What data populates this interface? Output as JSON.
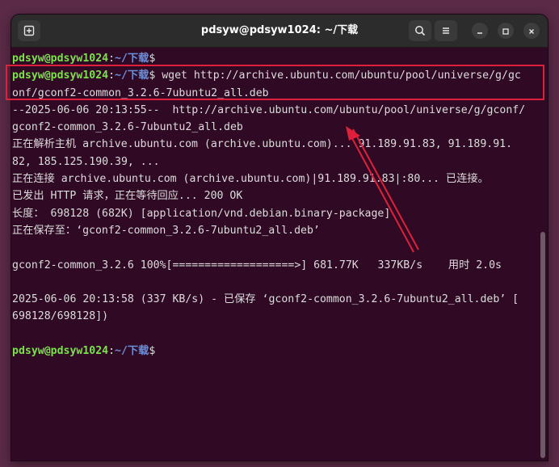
{
  "window": {
    "title": "pdsyw@pdsyw1024: ~/下载"
  },
  "titlebar_icons": {
    "new_tab": "new-tab-icon",
    "search": "search-icon",
    "menu": "hamburger-menu-icon",
    "minimize": "minimize-icon",
    "maximize": "maximize-icon",
    "close": "close-icon"
  },
  "prompt": {
    "user": "pdsyw@pdsyw1024",
    "sep": ":",
    "path": "~/下载",
    "sym": "$"
  },
  "terminal_lines": [
    {
      "type": "prompt",
      "cmd": ""
    },
    {
      "type": "prompt",
      "cmd": " wget http://archive.ubuntu.com/ubuntu/pool/universe/g/gc"
    },
    {
      "type": "text",
      "text": "onf/gconf2-common_3.2.6-7ubuntu2_all.deb"
    },
    {
      "type": "text",
      "text": "--2025-06-06 20:13:55--  http://archive.ubuntu.com/ubuntu/pool/universe/g/gconf/"
    },
    {
      "type": "text",
      "text": "gconf2-common_3.2.6-7ubuntu2_all.deb"
    },
    {
      "type": "text",
      "text": "正在解析主机 archive.ubuntu.com (archive.ubuntu.com)... 91.189.91.83, 91.189.91."
    },
    {
      "type": "text",
      "text": "82, 185.125.190.39, ..."
    },
    {
      "type": "text",
      "text": "正在连接 archive.ubuntu.com (archive.ubuntu.com)|91.189.91.83|:80... 已连接。"
    },
    {
      "type": "text",
      "text": "已发出 HTTP 请求，正在等待回应... 200 OK"
    },
    {
      "type": "text",
      "text": "长度： 698128 (682K) [application/vnd.debian.binary-package]"
    },
    {
      "type": "text",
      "text": "正在保存至：‘gconf2-common_3.2.6-7ubuntu2_all.deb’"
    },
    {
      "type": "text",
      "text": ""
    },
    {
      "type": "text",
      "text": "gconf2-common_3.2.6 100%[===================>] 681.77K   337KB/s    用时 2.0s"
    },
    {
      "type": "text",
      "text": ""
    },
    {
      "type": "text",
      "text": "2025-06-06 20:13:58 (337 KB/s) - 已保存 ‘gconf2-common_3.2.6-7ubuntu2_all.deb’ ["
    },
    {
      "type": "text",
      "text": "698128/698128])"
    },
    {
      "type": "text",
      "text": ""
    },
    {
      "type": "prompt",
      "cmd": ""
    }
  ],
  "annotation": {
    "box_color": "#e0203a",
    "arrow_color": "#e0203a"
  },
  "colors": {
    "terminal_bg": "#300a24",
    "user": "#7ae24b",
    "path": "#6b8fd9",
    "text": "#dcdcdc"
  }
}
